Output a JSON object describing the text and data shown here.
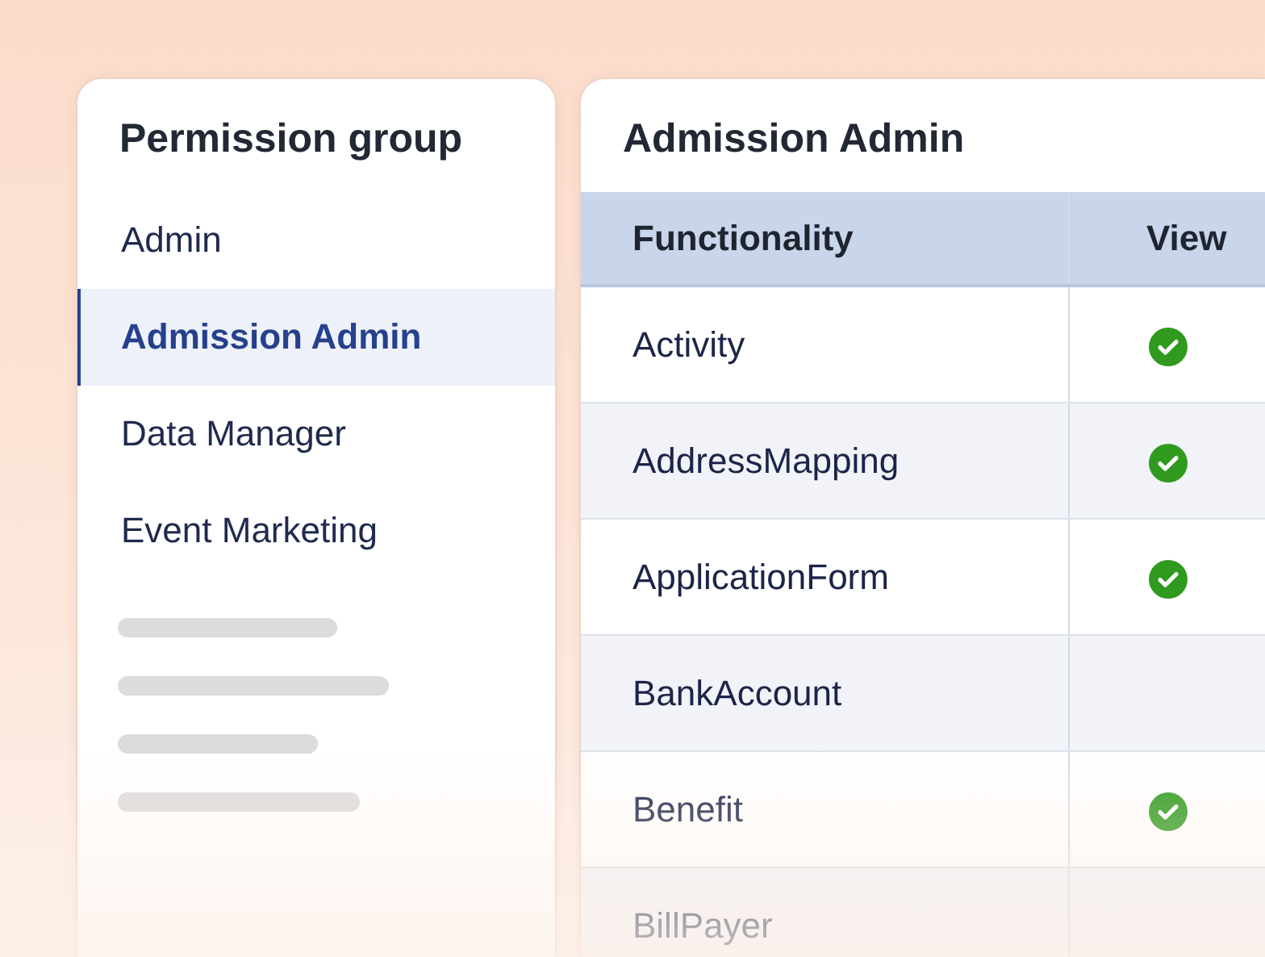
{
  "sidebar": {
    "title": "Permission group",
    "items": [
      {
        "kind": "group",
        "label": "Admin",
        "selected": false
      },
      {
        "kind": "group",
        "label": "Admission Admin",
        "selected": true
      },
      {
        "kind": "group",
        "label": "Data Manager",
        "selected": false
      },
      {
        "kind": "group",
        "label": "Event Marketing",
        "selected": false
      },
      {
        "kind": "placeholder"
      },
      {
        "kind": "placeholder"
      },
      {
        "kind": "placeholder"
      },
      {
        "kind": "placeholder"
      }
    ]
  },
  "panel": {
    "title": "Admission Admin",
    "table": {
      "columns": [
        "Functionality",
        "View"
      ],
      "rows": [
        {
          "functionality": "Activity",
          "view": true
        },
        {
          "functionality": "AddressMapping",
          "view": true
        },
        {
          "functionality": "ApplicationForm",
          "view": true
        },
        {
          "functionality": "BankAccount",
          "view": false
        },
        {
          "functionality": "Benefit",
          "view": true
        },
        {
          "functionality": "BillPayer",
          "view": false
        }
      ]
    }
  }
}
